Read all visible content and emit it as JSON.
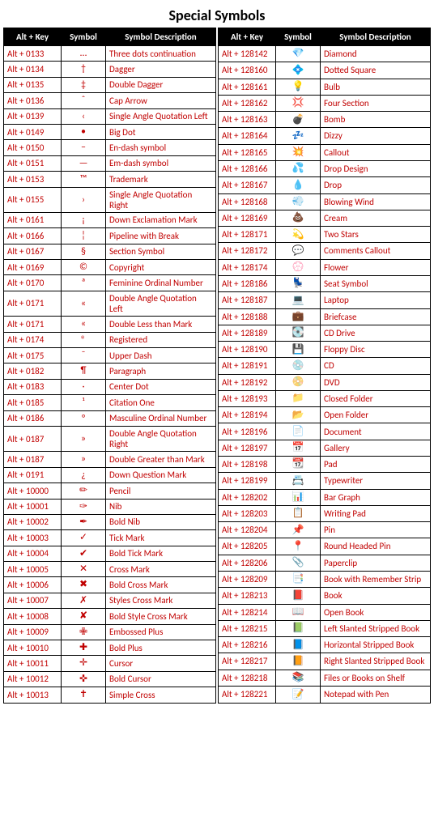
{
  "title": "Special Symbols",
  "headers": {
    "key": "Alt + Key",
    "symbol": "Symbol",
    "desc": "Symbol Description"
  },
  "left": [
    {
      "key": "Alt + 0133",
      "sym": "…",
      "desc": "Three dots continuation",
      "symRed": true
    },
    {
      "key": "Alt + 0134",
      "sym": "†",
      "desc": "Dagger",
      "symRed": true
    },
    {
      "key": "Alt + 0135",
      "sym": "‡",
      "desc": "Double Dagger",
      "symRed": true
    },
    {
      "key": "Alt + 0136",
      "sym": "ˆ",
      "desc": "Cap Arrow",
      "symRed": true
    },
    {
      "key": "Alt + 0139",
      "sym": "‹",
      "desc": "Single Angle Quotation Left",
      "symRed": true
    },
    {
      "key": "Alt + 0149",
      "sym": "•",
      "desc": "Big Dot",
      "symRed": true
    },
    {
      "key": "Alt + 0150",
      "sym": "–",
      "desc": "En-dash symbol",
      "symRed": true
    },
    {
      "key": "Alt + 0151",
      "sym": "—",
      "desc": "Em-dash symbol",
      "symRed": true
    },
    {
      "key": "Alt + 0153",
      "sym": "™",
      "desc": "Trademark",
      "symRed": true
    },
    {
      "key": "Alt + 0155",
      "sym": "›",
      "desc": "Single Angle Quotation Right",
      "symRed": true
    },
    {
      "key": "Alt + 0161",
      "sym": "¡",
      "desc": "Down Exclamation Mark",
      "symRed": true
    },
    {
      "key": "Alt + 0166",
      "sym": "¦",
      "desc": "Pipeline with Break",
      "symRed": true
    },
    {
      "key": "Alt + 0167",
      "sym": "§",
      "desc": "Section Symbol",
      "symRed": true
    },
    {
      "key": "Alt + 0169",
      "sym": "©",
      "desc": "Copyright",
      "symRed": true
    },
    {
      "key": "Alt + 0170",
      "sym": "ª",
      "desc": "Feminine Ordinal Number",
      "symRed": true
    },
    {
      "key": "Alt + 0171",
      "sym": "«",
      "desc": "Double Angle Quotation Left",
      "symRed": true
    },
    {
      "key": "Alt + 0171",
      "sym": "«",
      "desc": "Double Less than Mark",
      "symRed": true
    },
    {
      "key": "Alt + 0174",
      "sym": "®",
      "desc": "Registered",
      "symRed": true
    },
    {
      "key": "Alt + 0175",
      "sym": "¯",
      "desc": "Upper Dash",
      "symRed": true
    },
    {
      "key": "Alt + 0182",
      "sym": "¶",
      "desc": "Paragraph",
      "symRed": true
    },
    {
      "key": "Alt + 0183",
      "sym": "·",
      "desc": "Center Dot",
      "symRed": true
    },
    {
      "key": "Alt + 0185",
      "sym": "¹",
      "desc": "Citation One",
      "symRed": true
    },
    {
      "key": "Alt + 0186",
      "sym": "º",
      "desc": "Masculine Ordinal Number",
      "symRed": true
    },
    {
      "key": "Alt + 0187",
      "sym": "»",
      "desc": "Double Angle Quotation Right",
      "symRed": true
    },
    {
      "key": "Alt + 0187",
      "sym": "»",
      "desc": "Double Greater than Mark",
      "symRed": true
    },
    {
      "key": "Alt + 0191",
      "sym": "¿",
      "desc": "Down Question Mark",
      "symRed": true
    },
    {
      "key": "Alt + 10000",
      "sym": "✏",
      "desc": "Pencil",
      "symRed": true
    },
    {
      "key": "Alt + 10001",
      "sym": "✑",
      "desc": "Nib",
      "symRed": true
    },
    {
      "key": "Alt + 10002",
      "sym": "✒",
      "desc": "Bold Nib",
      "symRed": true
    },
    {
      "key": "Alt + 10003",
      "sym": "✓",
      "desc": "Tick Mark",
      "symRed": true
    },
    {
      "key": "Alt + 10004",
      "sym": "✔",
      "desc": "Bold Tick Mark",
      "symRed": true
    },
    {
      "key": "Alt + 10005",
      "sym": "✕",
      "desc": "Cross Mark",
      "symRed": true
    },
    {
      "key": "Alt + 10006",
      "sym": "✖",
      "desc": "Bold Cross Mark",
      "symRed": true
    },
    {
      "key": "Alt + 10007",
      "sym": "✗",
      "desc": "Styles Cross Mark",
      "symRed": true
    },
    {
      "key": "Alt + 10008",
      "sym": "✘",
      "desc": "Bold Style Cross Mark",
      "symRed": true
    },
    {
      "key": "Alt + 10009",
      "sym": "✙",
      "desc": "Embossed Plus",
      "symRed": true
    },
    {
      "key": "Alt + 10010",
      "sym": "✚",
      "desc": "Bold Plus",
      "symRed": true
    },
    {
      "key": "Alt + 10011",
      "sym": "✛",
      "desc": "Cursor",
      "symRed": true
    },
    {
      "key": "Alt + 10012",
      "sym": "✜",
      "desc": "Bold Cursor",
      "symRed": true
    },
    {
      "key": "Alt + 10013",
      "sym": "✝",
      "desc": "Simple Cross",
      "symRed": true
    }
  ],
  "right": [
    {
      "key": "Alt + 128142",
      "sym": "💎",
      "desc": "Diamond"
    },
    {
      "key": "Alt + 128160",
      "sym": "💠",
      "desc": "Dotted Square"
    },
    {
      "key": "Alt + 128161",
      "sym": "💡",
      "desc": "Bulb"
    },
    {
      "key": "Alt + 128162",
      "sym": "💢",
      "desc": "Four Section"
    },
    {
      "key": "Alt + 128163",
      "sym": "💣",
      "desc": "Bomb"
    },
    {
      "key": "Alt + 128164",
      "sym": "💤",
      "desc": "Dizzy"
    },
    {
      "key": "Alt + 128165",
      "sym": "💥",
      "desc": "Callout"
    },
    {
      "key": "Alt + 128166",
      "sym": "💦",
      "desc": "Drop Design"
    },
    {
      "key": "Alt + 128167",
      "sym": "💧",
      "desc": "Drop"
    },
    {
      "key": "Alt + 128168",
      "sym": "💨",
      "desc": "Blowing Wind"
    },
    {
      "key": "Alt + 128169",
      "sym": "💩",
      "desc": "Cream"
    },
    {
      "key": "Alt + 128171",
      "sym": "💫",
      "desc": "Two Stars"
    },
    {
      "key": "Alt + 128172",
      "sym": "💬",
      "desc": "Comments Callout"
    },
    {
      "key": "Alt + 128174",
      "sym": "💮",
      "desc": "Flower"
    },
    {
      "key": "Alt + 128186",
      "sym": "💺",
      "desc": "Seat Symbol"
    },
    {
      "key": "Alt + 128187",
      "sym": "💻",
      "desc": "Laptop"
    },
    {
      "key": "Alt + 128188",
      "sym": "💼",
      "desc": "Briefcase"
    },
    {
      "key": "Alt + 128189",
      "sym": "💽",
      "desc": "CD Drive"
    },
    {
      "key": "Alt + 128190",
      "sym": "💾",
      "desc": "Floppy Disc"
    },
    {
      "key": "Alt + 128191",
      "sym": "💿",
      "desc": "CD"
    },
    {
      "key": "Alt + 128192",
      "sym": "📀",
      "desc": "DVD"
    },
    {
      "key": "Alt + 128193",
      "sym": "📁",
      "desc": "Closed Folder"
    },
    {
      "key": "Alt + 128194",
      "sym": "📂",
      "desc": "Open Folder"
    },
    {
      "key": "Alt + 128196",
      "sym": "📄",
      "desc": "Document"
    },
    {
      "key": "Alt + 128197",
      "sym": "📅",
      "desc": "Gallery"
    },
    {
      "key": "Alt + 128198",
      "sym": "📆",
      "desc": "Pad"
    },
    {
      "key": "Alt + 128199",
      "sym": "📇",
      "desc": "Typewriter"
    },
    {
      "key": "Alt + 128202",
      "sym": "📊",
      "desc": "Bar Graph"
    },
    {
      "key": "Alt + 128203",
      "sym": "📋",
      "desc": "Writing Pad"
    },
    {
      "key": "Alt + 128204",
      "sym": "📌",
      "desc": "Pin"
    },
    {
      "key": "Alt + 128205",
      "sym": "📍",
      "desc": "Round Headed Pin"
    },
    {
      "key": "Alt + 128206",
      "sym": "📎",
      "desc": "Paperclip"
    },
    {
      "key": "Alt + 128209",
      "sym": "📑",
      "desc": "Book with Remember Strip"
    },
    {
      "key": "Alt + 128213",
      "sym": "📕",
      "desc": "Book"
    },
    {
      "key": "Alt + 128214",
      "sym": "📖",
      "desc": "Open Book"
    },
    {
      "key": "Alt + 128215",
      "sym": "📗",
      "desc": "Left Slanted Stripped Book"
    },
    {
      "key": "Alt + 128216",
      "sym": "📘",
      "desc": "Horizontal Stripped Book"
    },
    {
      "key": "Alt + 128217",
      "sym": "📙",
      "desc": "Right Slanted Stripped Book"
    },
    {
      "key": "Alt + 128218",
      "sym": "📚",
      "desc": "Files or Books on Shelf"
    },
    {
      "key": "Alt + 128221",
      "sym": "📝",
      "desc": "Notepad with Pen"
    }
  ]
}
